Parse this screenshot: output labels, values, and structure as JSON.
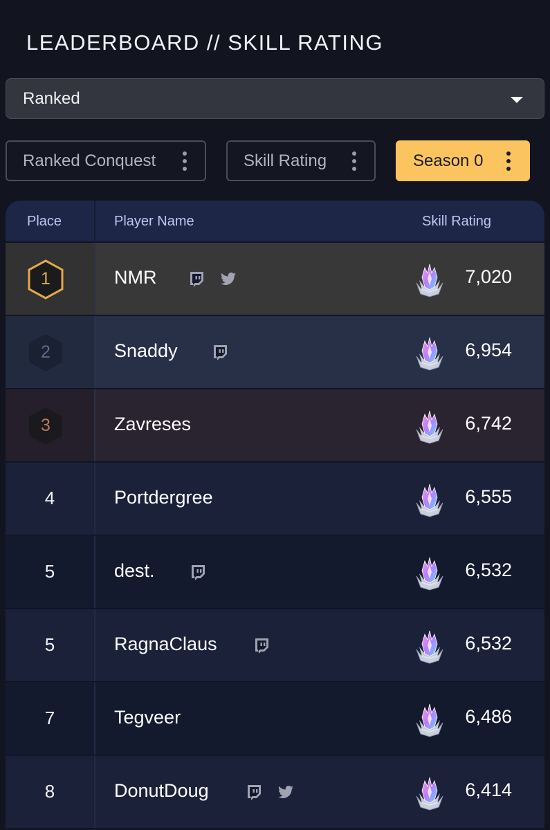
{
  "title": "LEADERBOARD // SKILL RATING",
  "mode_select": {
    "value": "Ranked"
  },
  "filters": [
    {
      "label": "Ranked Conquest",
      "active": false
    },
    {
      "label": "Skill Rating",
      "active": false
    },
    {
      "label": "Season 0",
      "active": true
    }
  ],
  "table": {
    "headers": {
      "place": "Place",
      "player": "Player Name",
      "rating": "Skill Rating"
    },
    "rows": [
      {
        "place": "1",
        "name": "NMR",
        "rating": "7,020",
        "socials": [
          "twitch-icon",
          "twitter-icon"
        ],
        "medal": "gold"
      },
      {
        "place": "2",
        "name": "Snaddy",
        "rating": "6,954",
        "socials": [
          "twitch-icon"
        ],
        "medal": "silver"
      },
      {
        "place": "3",
        "name": "Zavreses",
        "rating": "6,742",
        "socials": [],
        "medal": "bronze"
      },
      {
        "place": "4",
        "name": "Portdergree",
        "rating": "6,555",
        "socials": [],
        "medal": ""
      },
      {
        "place": "5",
        "name": "dest.",
        "rating": "6,532",
        "socials": [
          "twitch-icon"
        ],
        "medal": ""
      },
      {
        "place": "5",
        "name": "RagnaClaus",
        "rating": "6,532",
        "socials": [
          "twitch-icon"
        ],
        "medal": ""
      },
      {
        "place": "7",
        "name": "Tegveer",
        "rating": "6,486",
        "socials": [],
        "medal": ""
      },
      {
        "place": "8",
        "name": "DonutDoug",
        "rating": "6,414",
        "socials": [
          "twitch-icon",
          "twitter-icon"
        ],
        "medal": ""
      }
    ]
  },
  "colors": {
    "accent": "#fcc45f",
    "gold": "#e3a94a",
    "silver": "#5e6a84",
    "bronze": "#b97b52"
  }
}
